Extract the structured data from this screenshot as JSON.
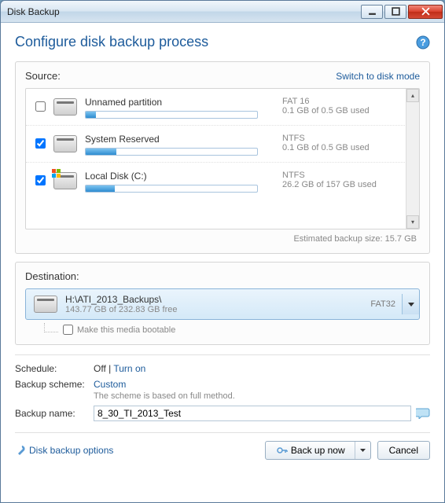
{
  "window": {
    "title": "Disk Backup"
  },
  "header": {
    "title": "Configure disk backup process"
  },
  "source": {
    "label": "Source:",
    "switch_link": "Switch to disk mode",
    "partitions": [
      {
        "name": "Unnamed partition",
        "fs": "FAT 16",
        "usage": "0.1 GB of 0.5 GB used",
        "checked": false,
        "fill_pct": 6,
        "has_flag": false
      },
      {
        "name": "System Reserved",
        "fs": "NTFS",
        "usage": "0.1 GB of 0.5 GB used",
        "checked": true,
        "fill_pct": 18,
        "has_flag": false
      },
      {
        "name": "Local Disk (C:)",
        "fs": "NTFS",
        "usage": "26.2 GB of 157 GB used",
        "checked": true,
        "fill_pct": 17,
        "has_flag": true
      }
    ],
    "estimate": "Estimated backup size: 15.7 GB"
  },
  "destination": {
    "label": "Destination:",
    "path": "H:\\ATI_2013_Backups\\",
    "free": "143.77 GB of 232.83 GB free",
    "fs": "FAT32",
    "bootable_label": "Make this media bootable"
  },
  "settings": {
    "schedule_label": "Schedule:",
    "schedule_value": "Off",
    "schedule_sep": " | ",
    "schedule_link": "Turn on",
    "scheme_label": "Backup scheme:",
    "scheme_link": "Custom",
    "scheme_desc": "The scheme is based on full method.",
    "name_label": "Backup name:",
    "name_value": "8_30_TI_2013_Test"
  },
  "footer": {
    "options_link": "Disk backup options",
    "backup_btn": "Back up now",
    "cancel_btn": "Cancel"
  }
}
